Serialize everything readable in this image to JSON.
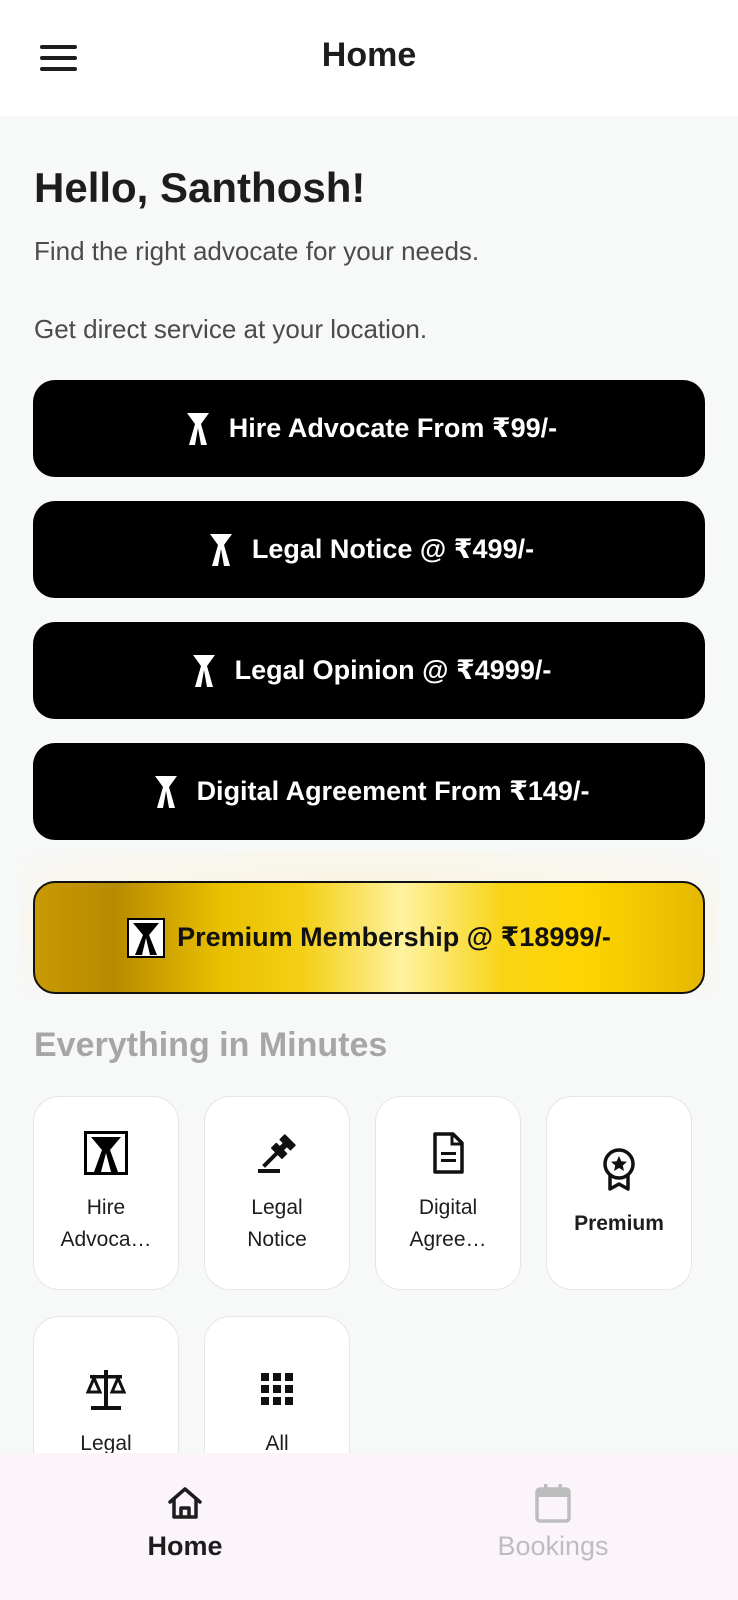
{
  "appbar": {
    "title": "Home",
    "menu_icon": "hamburger-menu-icon"
  },
  "greeting": {
    "title": "Hello, Santhosh!",
    "line1": "Find the right advocate for your needs.",
    "line2": "Get direct service at your location."
  },
  "cta_buttons": [
    {
      "label": "Hire Advocate From ₹99/-",
      "icon": "advocate-band-icon"
    },
    {
      "label": "Legal Notice @ ₹499/-",
      "icon": "advocate-band-icon"
    },
    {
      "label": "Legal Opinion @ ₹4999/-",
      "icon": "advocate-band-icon"
    },
    {
      "label": "Digital Agreement From ₹149/-",
      "icon": "advocate-band-icon"
    }
  ],
  "premium": {
    "label": "Premium Membership @ ₹18999/-",
    "icon": "advocate-band-icon",
    "colors": [
      "#b88a00",
      "#ffd500",
      "#fff2a0"
    ]
  },
  "section": {
    "title": "Everything in Minutes"
  },
  "tiles": [
    {
      "label": "Hire Advoca…",
      "icon": "advocate-band-icon"
    },
    {
      "label": "Legal Notice",
      "icon": "gavel-icon"
    },
    {
      "label": "Digital Agree…",
      "icon": "document-icon"
    },
    {
      "label": "Premium",
      "icon": "award-badge-icon"
    },
    {
      "label": "Legal",
      "icon": "scales-icon"
    },
    {
      "label": "All",
      "icon": "grid-icon"
    }
  ],
  "bottom_nav": {
    "home": {
      "label": "Home",
      "icon": "home-icon"
    },
    "bookings": {
      "label": "Bookings",
      "icon": "calendar-icon"
    }
  },
  "colors": {
    "accent": "#000000",
    "background": "#f7f8f8",
    "section_title": "#a6a6a6",
    "nav_inactive": "#bdbdbd"
  }
}
